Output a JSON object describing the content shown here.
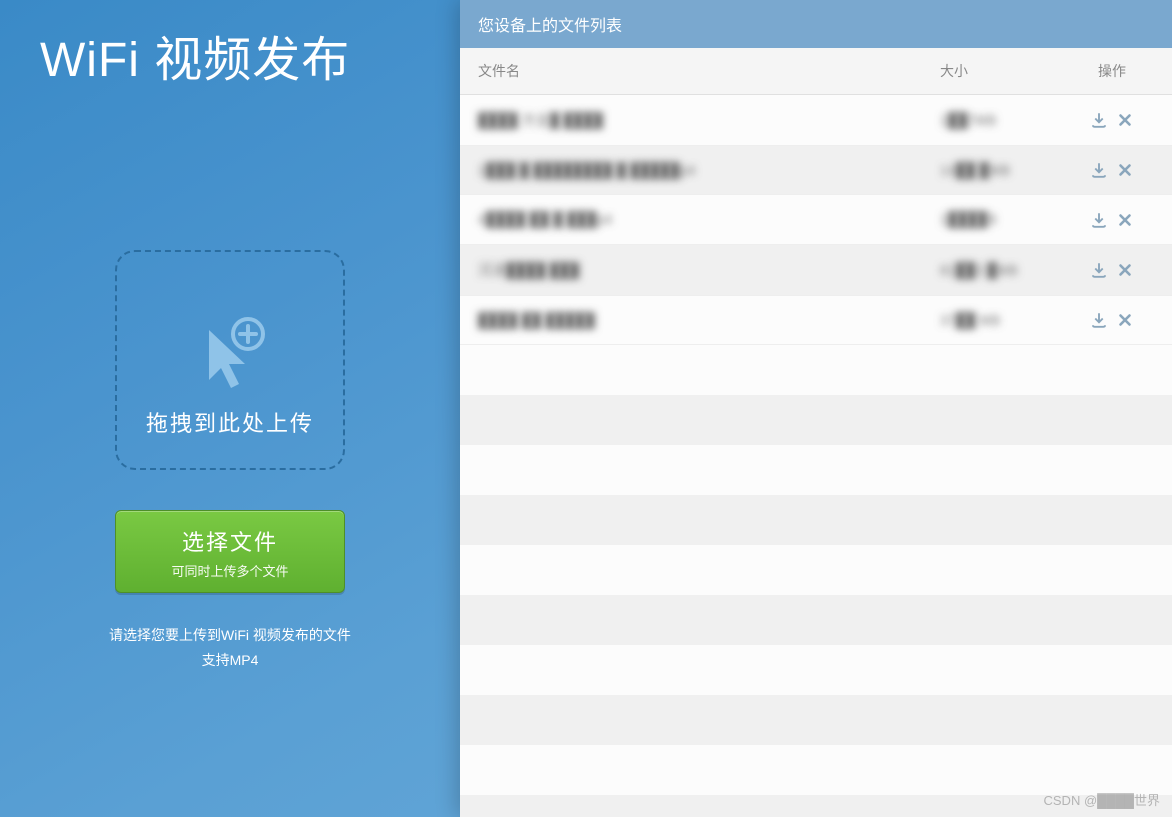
{
  "app": {
    "title": "WiFi 视频发布"
  },
  "dropzone": {
    "label": "拖拽到此处上传"
  },
  "choose_button": {
    "label": "选择文件",
    "sub": "可同时上传多个文件"
  },
  "help": {
    "line1": "请选择您要上传到WiFi 视频发布的文件",
    "line2": "支持MP4"
  },
  "panel": {
    "title": "您设备上的文件列表",
    "columns": {
      "name": "文件名",
      "size": "大小",
      "ops": "操作"
    },
    "files": [
      {
        "name": "████ 方全█ ████",
        "size": "1██7MB"
      },
      {
        "name": "1███ █ ████████ █ █████p4",
        "size": "14██ █MB"
      },
      {
        "name": "4████ ██ █ ███p4",
        "size": "1████B"
      },
      {
        "name": "沉浸████ ███",
        "size": "81██3 █MB"
      },
      {
        "name": "████ ██ █████",
        "size": "37██ MB"
      }
    ]
  },
  "watermark": "CSDN @████世界"
}
